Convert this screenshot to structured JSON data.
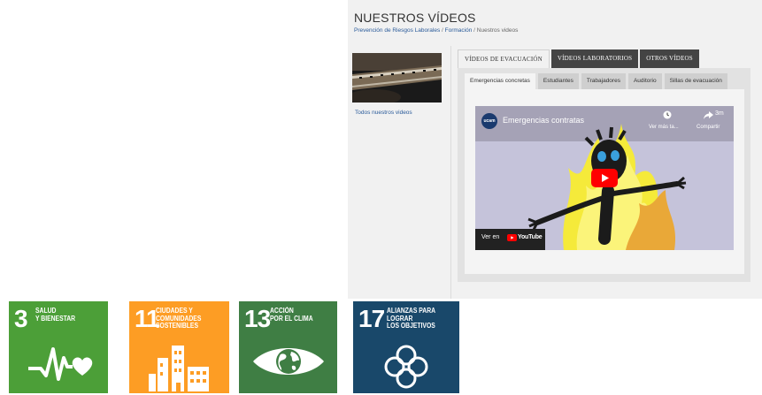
{
  "page": {
    "title": "NUESTROS VÍDEOS",
    "breadcrumb": {
      "item1": "Prevención de Riesgos Laborales",
      "sep1": " / ",
      "item2": "Formación",
      "sep2": " / ",
      "current": "Nuestros videos"
    }
  },
  "sidebar": {
    "link": "Todos nuestros videos"
  },
  "tabs": {
    "main": [
      "VÍDEOS DE EVACUACIÓN",
      "VÍDEOS LABORATORIOS",
      "OTROS VÍDEOS"
    ],
    "active_main": 0,
    "sub": [
      "Emergencias concretas",
      "Estudiantes",
      "Trabajadores",
      "Auditorio",
      "Sillas de evacuación"
    ],
    "active_sub": 0
  },
  "video": {
    "channel_logo": "ucam",
    "title": "Emergencias contratas",
    "watch_later": "Ver más ta...",
    "share_time": "3m",
    "share": "Compartir",
    "watch_on": "Ver en",
    "platform": "YouTube"
  },
  "sdg_tiles": [
    {
      "number": "3",
      "label_l1": "SALUD",
      "label_l2": "Y BIENESTAR",
      "label_l3": "",
      "color": "#4C9F38",
      "icon": "heartbeat-icon"
    },
    {
      "number": "11",
      "label_l1": "CIUDADES Y",
      "label_l2": "COMUNIDADES",
      "label_l3": "SOSTENIBLES",
      "color": "#FD9D24",
      "icon": "city-buildings-icon"
    },
    {
      "number": "13",
      "label_l1": "ACCIÓN",
      "label_l2": "POR EL CLIMA",
      "label_l3": "",
      "color": "#3F7E44",
      "icon": "eye-globe-icon"
    },
    {
      "number": "17",
      "label_l1": "ALIANZAS PARA",
      "label_l2": "LOGRAR",
      "label_l3": "LOS OBJETIVOS",
      "color": "#19486A",
      "icon": "partnership-rings-icon"
    }
  ]
}
